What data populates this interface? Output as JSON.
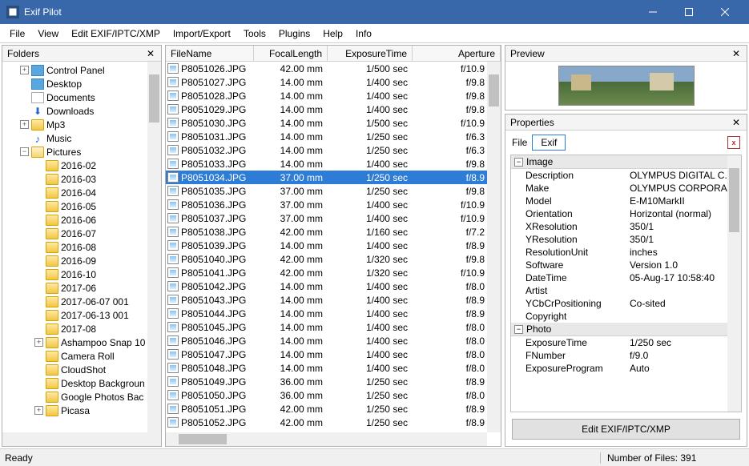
{
  "app": {
    "title": "Exif Pilot"
  },
  "menu": [
    "File",
    "View",
    "Edit EXIF/IPTC/XMP",
    "Import/Export",
    "Tools",
    "Plugins",
    "Help",
    "Info"
  ],
  "folders": {
    "title": "Folders",
    "items": [
      {
        "indent": 1,
        "expand": "+",
        "icon": "cp",
        "label": "Control Panel"
      },
      {
        "indent": 1,
        "expand": "",
        "icon": "desk",
        "label": "Desktop"
      },
      {
        "indent": 1,
        "expand": "",
        "icon": "doc",
        "label": "Documents"
      },
      {
        "indent": 1,
        "expand": "",
        "icon": "down",
        "label": "Downloads"
      },
      {
        "indent": 1,
        "expand": "+",
        "icon": "folder",
        "label": "Mp3"
      },
      {
        "indent": 1,
        "expand": "",
        "icon": "music",
        "label": "Music"
      },
      {
        "indent": 1,
        "expand": "-",
        "icon": "folder-open",
        "label": "Pictures"
      },
      {
        "indent": 2,
        "expand": "",
        "icon": "folder",
        "label": "2016-02"
      },
      {
        "indent": 2,
        "expand": "",
        "icon": "folder",
        "label": "2016-03"
      },
      {
        "indent": 2,
        "expand": "",
        "icon": "folder",
        "label": "2016-04"
      },
      {
        "indent": 2,
        "expand": "",
        "icon": "folder",
        "label": "2016-05"
      },
      {
        "indent": 2,
        "expand": "",
        "icon": "folder",
        "label": "2016-06"
      },
      {
        "indent": 2,
        "expand": "",
        "icon": "folder",
        "label": "2016-07"
      },
      {
        "indent": 2,
        "expand": "",
        "icon": "folder",
        "label": "2016-08"
      },
      {
        "indent": 2,
        "expand": "",
        "icon": "folder",
        "label": "2016-09"
      },
      {
        "indent": 2,
        "expand": "",
        "icon": "folder",
        "label": "2016-10"
      },
      {
        "indent": 2,
        "expand": "",
        "icon": "folder",
        "label": "2017-06"
      },
      {
        "indent": 2,
        "expand": "",
        "icon": "folder",
        "label": "2017-06-07 001"
      },
      {
        "indent": 2,
        "expand": "",
        "icon": "folder",
        "label": "2017-06-13 001"
      },
      {
        "indent": 2,
        "expand": "",
        "icon": "folder",
        "label": "2017-08"
      },
      {
        "indent": 2,
        "expand": "+",
        "icon": "folder",
        "label": "Ashampoo Snap 10"
      },
      {
        "indent": 2,
        "expand": "",
        "icon": "folder",
        "label": "Camera Roll"
      },
      {
        "indent": 2,
        "expand": "",
        "icon": "folder",
        "label": "CloudShot"
      },
      {
        "indent": 2,
        "expand": "",
        "icon": "folder",
        "label": "Desktop Backgroun"
      },
      {
        "indent": 2,
        "expand": "",
        "icon": "folder",
        "label": "Google Photos Bac"
      },
      {
        "indent": 2,
        "expand": "+",
        "icon": "folder",
        "label": "Picasa"
      }
    ]
  },
  "filelist": {
    "columns": {
      "name": "FileName",
      "focal": "FocalLength",
      "exp": "ExposureTime",
      "ap": "Aperture"
    },
    "selected_index": 8,
    "rows": [
      {
        "name": "P8051026.JPG",
        "focal": "42.00 mm",
        "exp": "1/500 sec",
        "ap": "f/10.9"
      },
      {
        "name": "P8051027.JPG",
        "focal": "14.00 mm",
        "exp": "1/400 sec",
        "ap": "f/9.8"
      },
      {
        "name": "P8051028.JPG",
        "focal": "14.00 mm",
        "exp": "1/400 sec",
        "ap": "f/9.8"
      },
      {
        "name": "P8051029.JPG",
        "focal": "14.00 mm",
        "exp": "1/400 sec",
        "ap": "f/9.8"
      },
      {
        "name": "P8051030.JPG",
        "focal": "14.00 mm",
        "exp": "1/500 sec",
        "ap": "f/10.9"
      },
      {
        "name": "P8051031.JPG",
        "focal": "14.00 mm",
        "exp": "1/250 sec",
        "ap": "f/6.3"
      },
      {
        "name": "P8051032.JPG",
        "focal": "14.00 mm",
        "exp": "1/250 sec",
        "ap": "f/6.3"
      },
      {
        "name": "P8051033.JPG",
        "focal": "14.00 mm",
        "exp": "1/400 sec",
        "ap": "f/9.8"
      },
      {
        "name": "P8051034.JPG",
        "focal": "37.00 mm",
        "exp": "1/250 sec",
        "ap": "f/8.9"
      },
      {
        "name": "P8051035.JPG",
        "focal": "37.00 mm",
        "exp": "1/250 sec",
        "ap": "f/9.8"
      },
      {
        "name": "P8051036.JPG",
        "focal": "37.00 mm",
        "exp": "1/400 sec",
        "ap": "f/10.9"
      },
      {
        "name": "P8051037.JPG",
        "focal": "37.00 mm",
        "exp": "1/400 sec",
        "ap": "f/10.9"
      },
      {
        "name": "P8051038.JPG",
        "focal": "42.00 mm",
        "exp": "1/160 sec",
        "ap": "f/7.2"
      },
      {
        "name": "P8051039.JPG",
        "focal": "14.00 mm",
        "exp": "1/400 sec",
        "ap": "f/8.9"
      },
      {
        "name": "P8051040.JPG",
        "focal": "42.00 mm",
        "exp": "1/320 sec",
        "ap": "f/9.8"
      },
      {
        "name": "P8051041.JPG",
        "focal": "42.00 mm",
        "exp": "1/320 sec",
        "ap": "f/10.9"
      },
      {
        "name": "P8051042.JPG",
        "focal": "14.00 mm",
        "exp": "1/400 sec",
        "ap": "f/8.0"
      },
      {
        "name": "P8051043.JPG",
        "focal": "14.00 mm",
        "exp": "1/400 sec",
        "ap": "f/8.9"
      },
      {
        "name": "P8051044.JPG",
        "focal": "14.00 mm",
        "exp": "1/400 sec",
        "ap": "f/8.9"
      },
      {
        "name": "P8051045.JPG",
        "focal": "14.00 mm",
        "exp": "1/400 sec",
        "ap": "f/8.0"
      },
      {
        "name": "P8051046.JPG",
        "focal": "14.00 mm",
        "exp": "1/400 sec",
        "ap": "f/8.0"
      },
      {
        "name": "P8051047.JPG",
        "focal": "14.00 mm",
        "exp": "1/400 sec",
        "ap": "f/8.0"
      },
      {
        "name": "P8051048.JPG",
        "focal": "14.00 mm",
        "exp": "1/400 sec",
        "ap": "f/8.0"
      },
      {
        "name": "P8051049.JPG",
        "focal": "36.00 mm",
        "exp": "1/250 sec",
        "ap": "f/8.9"
      },
      {
        "name": "P8051050.JPG",
        "focal": "36.00 mm",
        "exp": "1/250 sec",
        "ap": "f/8.0"
      },
      {
        "name": "P8051051.JPG",
        "focal": "42.00 mm",
        "exp": "1/250 sec",
        "ap": "f/8.9"
      },
      {
        "name": "P8051052.JPG",
        "focal": "42.00 mm",
        "exp": "1/250 sec",
        "ap": "f/8.9"
      }
    ]
  },
  "preview": {
    "title": "Preview"
  },
  "properties": {
    "title": "Properties",
    "tab_file": "File",
    "tab_exif": "Exif",
    "groups": [
      {
        "title": "Image",
        "rows": [
          {
            "k": "Description",
            "v": "OLYMPUS DIGITAL C..."
          },
          {
            "k": "Make",
            "v": "OLYMPUS CORPORA..."
          },
          {
            "k": "Model",
            "v": "E-M10MarkII"
          },
          {
            "k": "Orientation",
            "v": "Horizontal (normal)"
          },
          {
            "k": "XResolution",
            "v": "350/1"
          },
          {
            "k": "YResolution",
            "v": "350/1"
          },
          {
            "k": "ResolutionUnit",
            "v": "inches"
          },
          {
            "k": "Software",
            "v": "Version 1.0"
          },
          {
            "k": "DateTime",
            "v": "05-Aug-17 10:58:40"
          },
          {
            "k": "Artist",
            "v": ""
          },
          {
            "k": "YCbCrPositioning",
            "v": "Co-sited"
          },
          {
            "k": "Copyright",
            "v": ""
          }
        ]
      },
      {
        "title": "Photo",
        "rows": [
          {
            "k": "ExposureTime",
            "v": "1/250 sec"
          },
          {
            "k": "FNumber",
            "v": "f/9.0"
          },
          {
            "k": "ExposureProgram",
            "v": "Auto"
          }
        ]
      }
    ],
    "edit_button": "Edit EXIF/IPTC/XMP"
  },
  "status": {
    "left": "Ready",
    "right": "Number of Files: 391"
  }
}
